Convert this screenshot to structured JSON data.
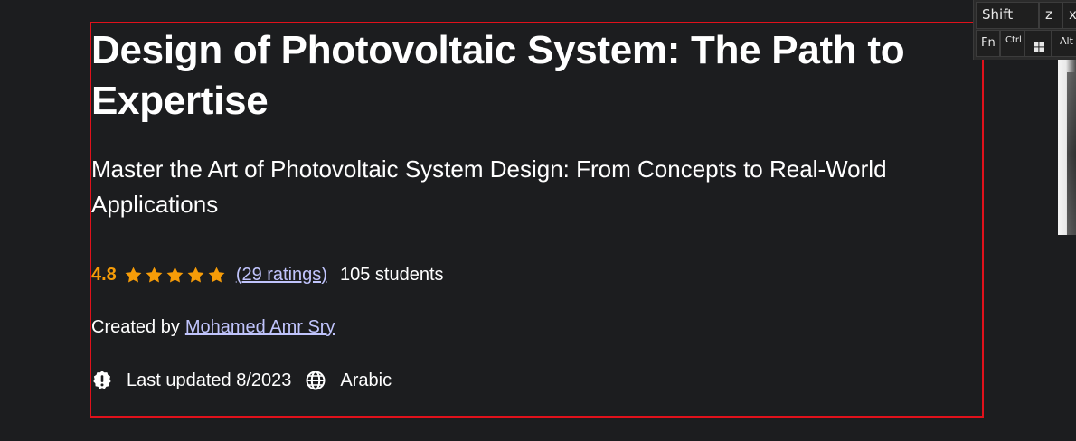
{
  "course": {
    "title": "Design of Photovoltaic System: The Path to Expertise",
    "subtitle": "Master the Art of Photovoltaic System Design: From Concepts to Real-World Applications",
    "rating": "4.8",
    "stars": 5,
    "ratings_count": "(29 ratings)",
    "students": "105 students",
    "created_by_label": "Created by",
    "author": "Mohamed Amr Sry",
    "last_updated": "Last updated 8/2023",
    "language": "Arabic"
  },
  "icons": {
    "star": "star-icon",
    "update": "alert-badge-icon",
    "language": "globe-icon",
    "windows": "windows-logo-icon"
  },
  "colors": {
    "background": "#1c1d1f",
    "rating": "#f69c08",
    "link": "#c0c4fc",
    "highlight_border": "#e0111b"
  },
  "keyboard": {
    "shift": "Shift",
    "z": "z",
    "x": "x",
    "fn": "Fn",
    "ctrl": "Ctrl",
    "alt": "Alt"
  }
}
